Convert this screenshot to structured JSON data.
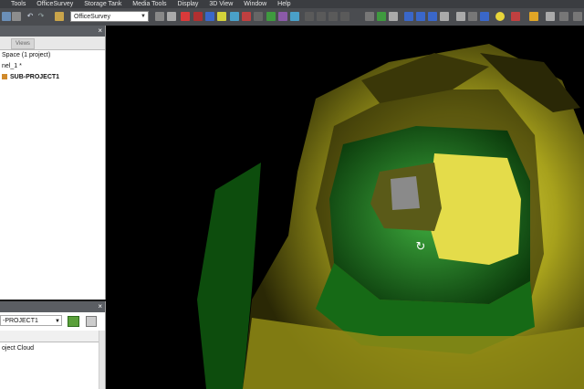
{
  "menu": {
    "items": [
      "Tools",
      "OfficeSurvey",
      "Storage Tank",
      "Media Tools",
      "Display",
      "3D View",
      "Window",
      "Help"
    ]
  },
  "toolbar": {
    "workflow_value": "OfficeSurvey"
  },
  "project_panel": {
    "tab_label": "Views",
    "tree": [
      {
        "label": "Space  (1 project)",
        "bold": false
      },
      {
        "label": "nel_1  *",
        "bold": false
      },
      {
        "label": "SUB-PROJECT1",
        "bold": true
      }
    ]
  },
  "cloud_panel": {
    "selector_value": "-PROJECT1",
    "list": [
      "oject Cloud"
    ]
  },
  "colors": {
    "tunnel_yellow": "#c9c22a",
    "tunnel_green": "#1f8f1f",
    "panel_header": "#5b5e63",
    "menu_bg": "#3b3d41"
  },
  "viewport": {
    "cursor_icon": "rotate-cursor-icon"
  }
}
